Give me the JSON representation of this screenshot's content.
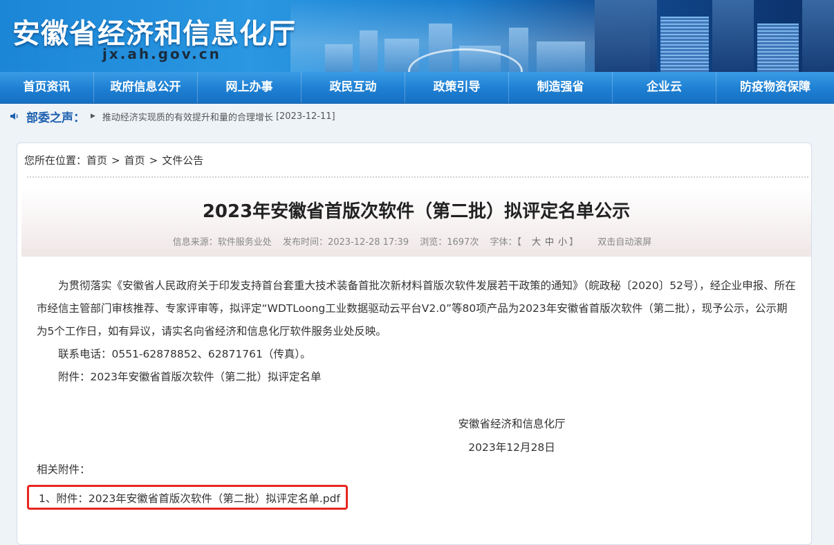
{
  "header": {
    "site_title": "安徽省经济和信息化厅",
    "site_domain": "jx.ah.gov.cn"
  },
  "nav": {
    "items": [
      {
        "label": "首页资讯"
      },
      {
        "label": "政府信息公开"
      },
      {
        "label": "网上办事"
      },
      {
        "label": "政民互动"
      },
      {
        "label": "政策引导"
      },
      {
        "label": "制造强省"
      },
      {
        "label": "企业云"
      },
      {
        "label": "防疫物资保障"
      }
    ]
  },
  "notice": {
    "label": "部委之声：",
    "headline": "推动经济实现质的有效提升和量的合理增长",
    "date": "[2023-12-11]"
  },
  "breadcrumb": {
    "prefix": "您所在位置：",
    "items": [
      "首页",
      "首页",
      "文件公告"
    ],
    "separator": ">"
  },
  "article": {
    "title": "2023年安徽省首版次软件（第二批）拟评定名单公示",
    "meta": {
      "source": "信息来源：软件服务业处",
      "published": "发布时间：2023-12-28 17:39",
      "views": "浏览：1697次",
      "font_size_label": "字体：【",
      "font_large": "大",
      "font_medium": "中",
      "font_small": "小",
      "font_size_close": "】",
      "auto_scroll": "双击自动滚屏"
    },
    "paragraphs": [
      "为贯彻落实《安徽省人民政府关于印发支持首台套重大技术装备首批次新材料首版次软件发展若干政策的通知》（皖政秘〔2020〕52号），经企业申报、所在市经信主管部门审核推荐、专家评审等，拟评定“WDTLoong工业数据驱动云平台V2.0”等80项产品为2023年安徽省首版次软件（第二批），现予公示，公示期为5个工作日，如有异议，请实名向省经济和信息化厅软件服务业处反映。",
      "联系电话：0551-62878852、62871761（传真）。",
      "附件：2023年安徽省首版次软件（第二批）拟评定名单"
    ],
    "signature": {
      "org": "安徽省经济和信息化厅",
      "date": "2023年12月28日"
    },
    "related_label": "相关附件：",
    "attachments": [
      {
        "label": "1、附件：2023年安徽省首版次软件（第二批）拟评定名单.pdf"
      }
    ]
  },
  "colors": {
    "nav_bg": "#1e7fd2",
    "notice_label": "#1c5fae",
    "highlight_border": "#e8251f"
  }
}
